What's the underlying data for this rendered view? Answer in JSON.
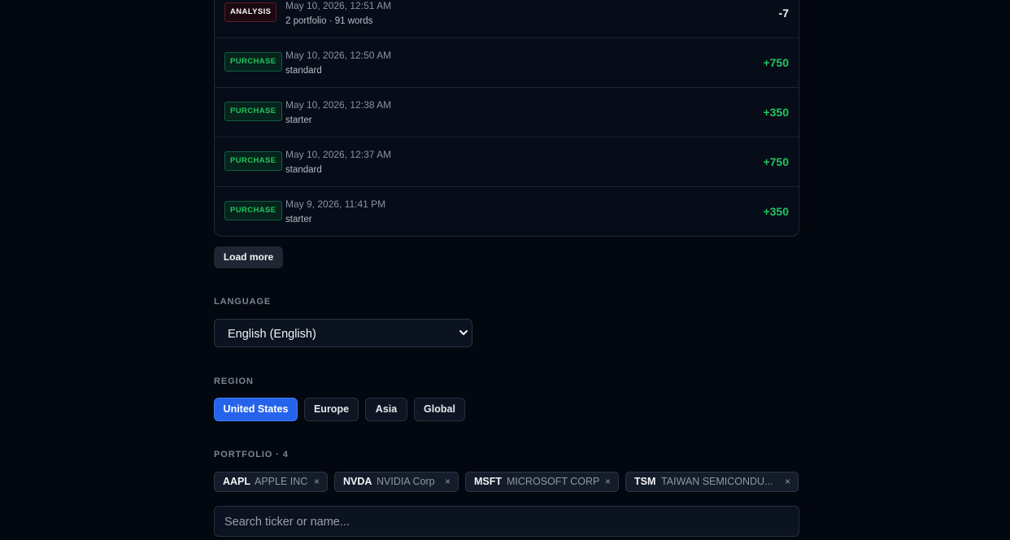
{
  "transactions": [
    {
      "type": "ANALYSIS",
      "date": "May 10, 2026, 12:51 AM",
      "desc": "2 portfolio · 91 words",
      "amount": "-7"
    },
    {
      "type": "PURCHASE",
      "date": "May 10, 2026, 12:50 AM",
      "desc": "standard",
      "amount": "+750"
    },
    {
      "type": "PURCHASE",
      "date": "May 10, 2026, 12:38 AM",
      "desc": "starter",
      "amount": "+350"
    },
    {
      "type": "PURCHASE",
      "date": "May 10, 2026, 12:37 AM",
      "desc": "standard",
      "amount": "+750"
    },
    {
      "type": "PURCHASE",
      "date": "May 9, 2026, 11:41 PM",
      "desc": "starter",
      "amount": "+350"
    }
  ],
  "load_more_label": "Load more",
  "language": {
    "label": "LANGUAGE",
    "selected": "English (English)"
  },
  "region": {
    "label": "REGION",
    "options": [
      "United States",
      "Europe",
      "Asia",
      "Global"
    ],
    "selected": "United States"
  },
  "portfolio": {
    "label": "PORTFOLIO · 4",
    "items": [
      {
        "symbol": "AAPL",
        "name": "APPLE INC",
        "remove": "×"
      },
      {
        "symbol": "NVDA",
        "name": "NVIDIA Corp",
        "remove": "×"
      },
      {
        "symbol": "MSFT",
        "name": "MICROSOFT CORP",
        "remove": "×"
      },
      {
        "symbol": "TSM",
        "name": "TAIWAN SEMICONDU...",
        "remove": "×"
      }
    ]
  },
  "search": {
    "placeholder": "Search ticker or name..."
  },
  "colors": {
    "accent": "#2563eb",
    "positive": "#22c55e",
    "background": "#03070f"
  }
}
